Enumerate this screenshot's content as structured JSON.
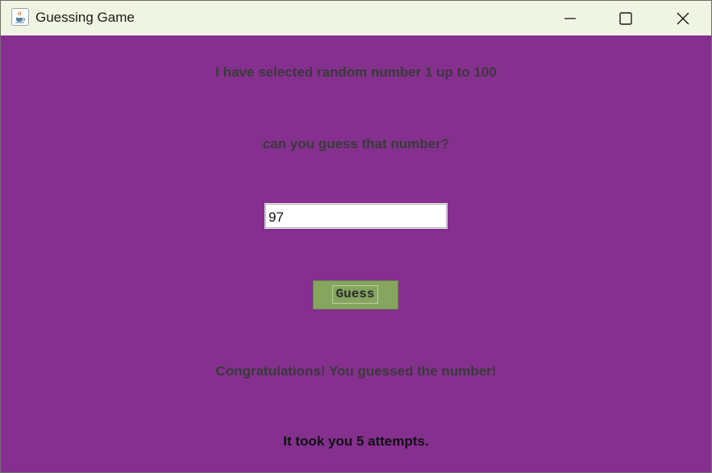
{
  "window": {
    "title": "Guessing Game",
    "icon": "java-cup-icon"
  },
  "title_controls": {
    "minimize_icon": "minimize-icon",
    "maximize_icon": "maximize-icon",
    "close_icon": "close-icon"
  },
  "content": {
    "background_color": "#85308f",
    "prompt_line1": "I have selected random number 1 up to 100",
    "prompt_line2": "can you guess that number?",
    "guess_input_value": "97",
    "guess_button_label": "Guess",
    "guess_button_color": "#86a55e",
    "result_message": "Congratulations! You guessed the number!",
    "attempts_message": "It took you 5 attempts."
  }
}
